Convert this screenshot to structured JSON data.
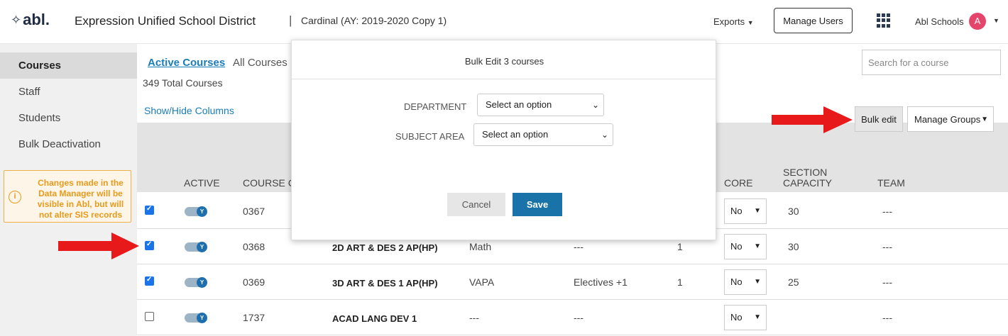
{
  "header": {
    "logo_text": "abl.",
    "district": "Expression Unified School District",
    "separator": "|",
    "context": "Cardinal (AY: 2019-2020 Copy 1)",
    "exports_label": "Exports",
    "manage_users_label": "Manage Users",
    "account_label": "Abl Schools",
    "avatar_initial": "A"
  },
  "sidebar": {
    "items": [
      {
        "label": "Courses"
      },
      {
        "label": "Staff"
      },
      {
        "label": "Students"
      },
      {
        "label": "Bulk Deactivation"
      }
    ],
    "notice": "Changes made in the Data Manager will be visible in Abl, but will not alter SIS records"
  },
  "main": {
    "tab_active": "Active Courses",
    "tab_all": "All Courses",
    "total": "349 Total Courses",
    "show_hide": "Show/Hide Columns",
    "search_placeholder": "Search for a course",
    "bulk_edit_label": "Bulk edit",
    "manage_groups_label": "Manage Groups"
  },
  "table": {
    "headers": {
      "active": "ACTIVE",
      "course_code": "COURSE C",
      "core": "CORE",
      "section_capacity_1": "SECTION",
      "section_capacity_2": "CAPACITY",
      "team": "TEAM"
    },
    "rows": [
      {
        "checked": true,
        "code": "0367",
        "name": "",
        "subject": "",
        "dept": "",
        "num": "",
        "core": "No",
        "capacity": "30",
        "team": "---"
      },
      {
        "checked": true,
        "code": "0368",
        "name": "2D ART & DES 2 AP(HP)",
        "subject": "Math",
        "dept": "---",
        "num": "1",
        "core": "No",
        "capacity": "30",
        "team": "---"
      },
      {
        "checked": true,
        "code": "0369",
        "name": "3D ART & DES 1 AP(HP)",
        "subject": "VAPA",
        "dept": "Electives +1",
        "num": "1",
        "core": "No",
        "capacity": "25",
        "team": "---"
      },
      {
        "checked": false,
        "code": "1737",
        "name": "ACAD LANG DEV 1",
        "subject": "---",
        "dept": "---",
        "num": "",
        "core": "No",
        "capacity": "",
        "team": "---"
      }
    ]
  },
  "modal": {
    "title": "Bulk Edit 3 courses",
    "department_label": "DEPARTMENT",
    "department_value": "Select an option",
    "subject_label": "SUBJECT AREA",
    "subject_value": "Select an option",
    "cancel_label": "Cancel",
    "save_label": "Save"
  },
  "colors": {
    "accent": "#1a7cb8",
    "save": "#1a73a8",
    "warning": "#e89a1c",
    "arrow": "#e8191b",
    "avatar": "#e6456b"
  }
}
